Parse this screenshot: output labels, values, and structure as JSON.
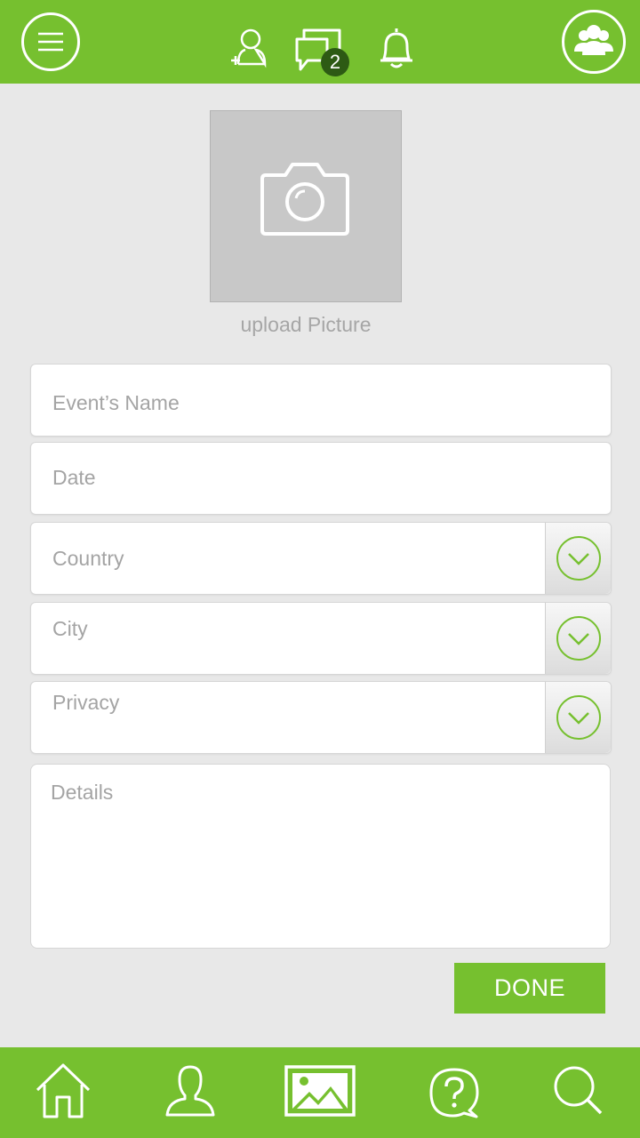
{
  "header": {
    "messages_badge": "2",
    "icons": [
      "menu-icon",
      "add-friend-icon",
      "messages-icon",
      "notifications-icon",
      "groups-icon"
    ]
  },
  "upload": {
    "label": "upload Picture",
    "icon": "camera-icon"
  },
  "form": {
    "event_name_placeholder": "Event’s Name",
    "date_placeholder": "Date",
    "country_placeholder": "Country",
    "city_placeholder": "City",
    "privacy_placeholder": "Privacy",
    "details_placeholder": "Details"
  },
  "done_label": "DONE",
  "bottom_nav": {
    "items": [
      "home-icon",
      "profile-icon",
      "gallery-icon",
      "help-icon",
      "search-icon"
    ]
  },
  "colors": {
    "accent": "#76c02f",
    "badge": "#2d5a14",
    "background": "#e8e8e8"
  }
}
